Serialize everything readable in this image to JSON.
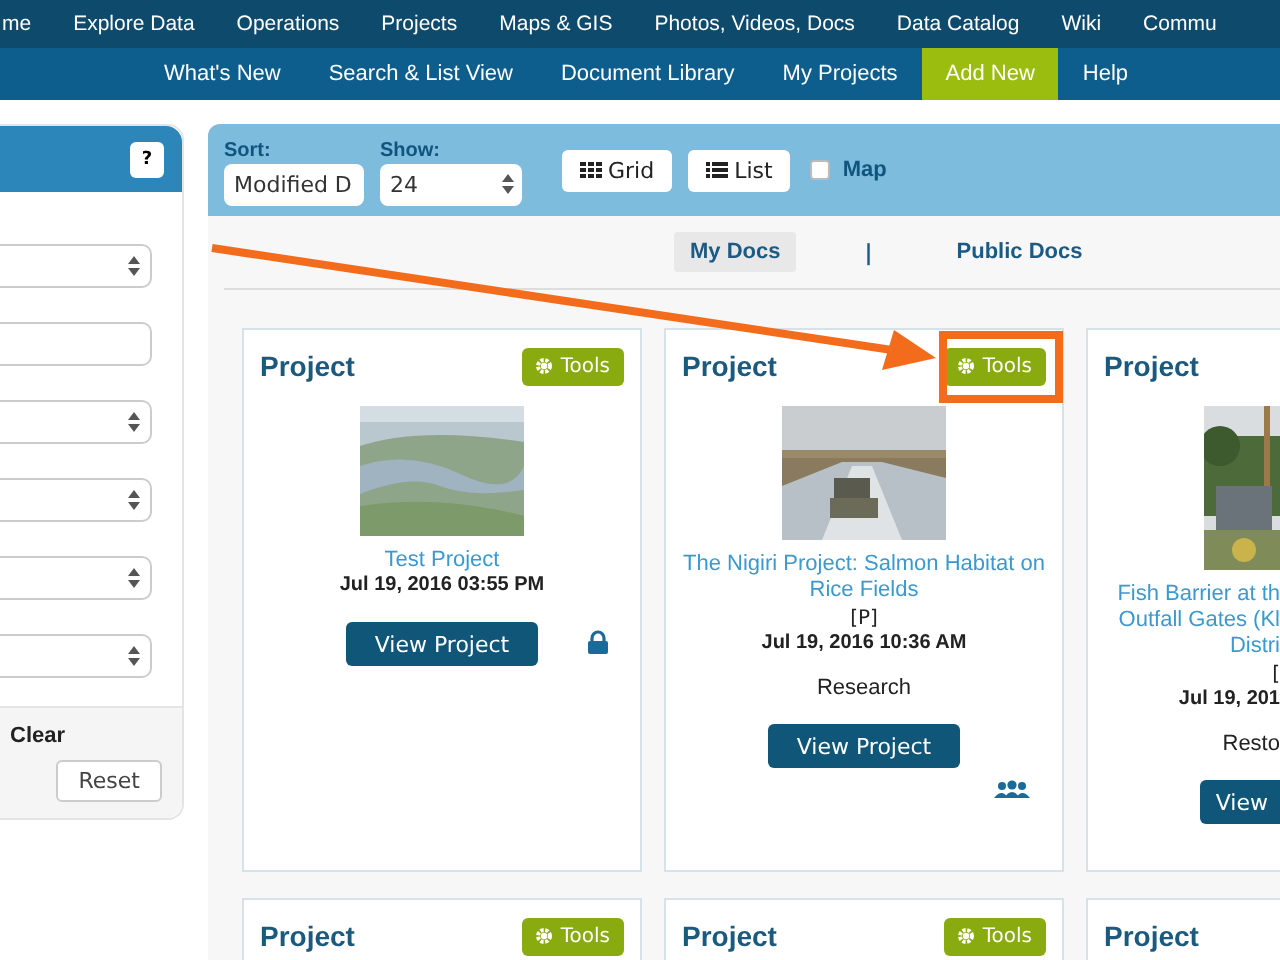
{
  "main_nav": [
    {
      "label": "me"
    },
    {
      "label": "Explore Data"
    },
    {
      "label": "Operations"
    },
    {
      "label": "Projects"
    },
    {
      "label": "Maps & GIS"
    },
    {
      "label": "Photos, Videos, Docs"
    },
    {
      "label": "Data Catalog"
    },
    {
      "label": "Wiki"
    },
    {
      "label": "Commu"
    }
  ],
  "sub_nav": [
    {
      "label": "What's New",
      "selected": false
    },
    {
      "label": "Search & List View",
      "selected": false
    },
    {
      "label": "Document Library",
      "selected": false
    },
    {
      "label": "My Projects",
      "selected": false
    },
    {
      "label": "Add New",
      "selected": true
    },
    {
      "label": "Help",
      "selected": false
    }
  ],
  "filter_panel": {
    "help": "?",
    "fields": [
      {
        "kind": "select"
      },
      {
        "kind": "input"
      },
      {
        "kind": "select"
      },
      {
        "kind": "select"
      },
      {
        "kind": "select"
      },
      {
        "kind": "select"
      }
    ],
    "clear": "Clear",
    "reset": "Reset"
  },
  "toolbar": {
    "sort_label": "Sort:",
    "sort_value": "Modified D",
    "show_label": "Show:",
    "show_value": "24",
    "views": [
      {
        "label": "Grid",
        "kind": "grid"
      },
      {
        "label": "List",
        "kind": "list"
      }
    ],
    "map": {
      "label": "Map",
      "checked": false
    }
  },
  "doc_tabs": [
    {
      "label": "My Docs",
      "selected": true
    },
    {
      "label": "|",
      "kind": "divider"
    },
    {
      "label": "Public Docs",
      "selected": false
    }
  ],
  "cards": [
    {
      "heading": "Project",
      "tools": "Tools",
      "title_lines": [
        "Test Project"
      ],
      "date": "Jul 19, 2016 03:55 PM",
      "button": "View Project",
      "private": true,
      "clipped": false,
      "picture": {
        "kind": "picture"
      }
    },
    {
      "heading": "Project",
      "tools": "Tools",
      "title_lines": [
        "The Nigiri Project: Salmon Habitat on",
        "Rice Fields"
      ],
      "tag": "[P]",
      "date": "Jul 19, 2016 10:36 AM",
      "category": "Research",
      "button": "View Project",
      "shared": true,
      "clipped": false,
      "picture": {
        "kind": "picture"
      }
    },
    {
      "heading": "Project",
      "title_lines": [
        "Fish Barrier at th",
        "Outfall Gates (Kl",
        "Distri"
      ],
      "tag": "[",
      "date": "Jul 19, 201",
      "category": "Resto",
      "button": "View",
      "clipped": true,
      "picture": {
        "kind": "picture"
      }
    },
    {
      "heading": "Project",
      "tools": "Tools",
      "clipped": false
    },
    {
      "heading": "Project",
      "tools": "Tools",
      "clipped": false
    },
    {
      "heading": "Project",
      "clipped": true
    }
  ]
}
